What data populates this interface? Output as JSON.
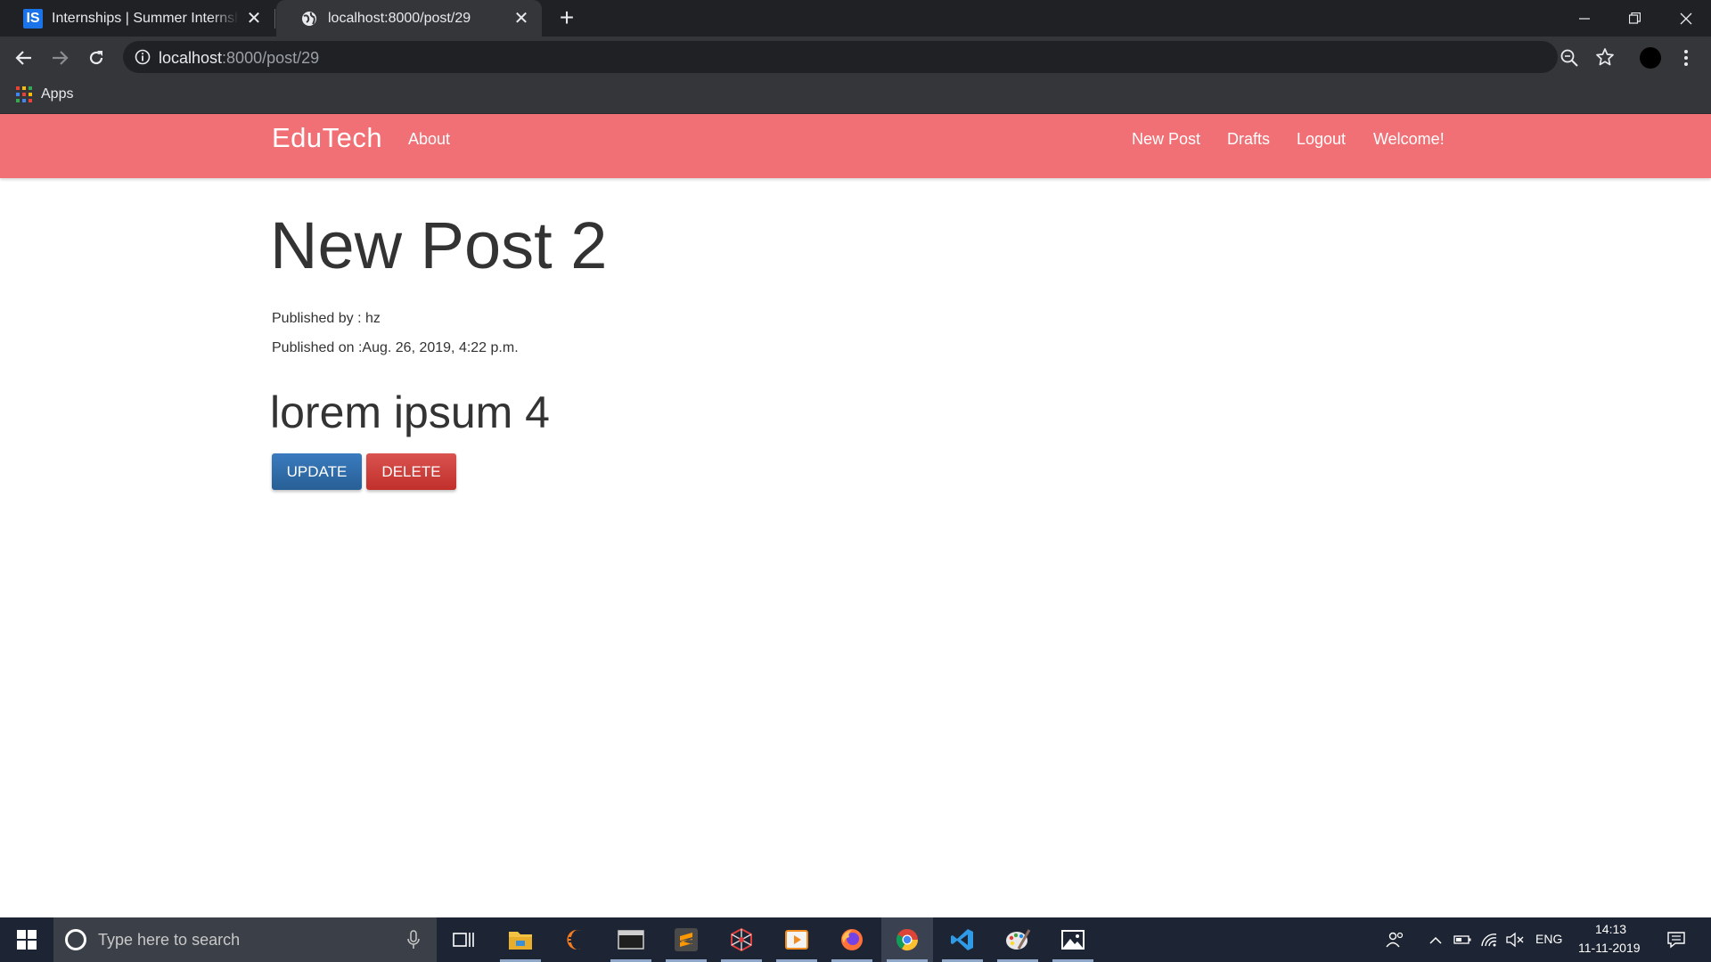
{
  "browser": {
    "tabs": [
      {
        "title": "Internships | Summer Internship | ",
        "favicon_text": "IS",
        "active": false
      },
      {
        "title": "localhost:8000/post/29",
        "favicon": "globe-icon",
        "active": true
      }
    ],
    "url_host": "localhost",
    "url_rest": ":8000/post/29",
    "bookmarks": {
      "apps_label": "Apps"
    }
  },
  "site": {
    "brand": "EduTech",
    "nav_left": [
      "About"
    ],
    "nav_right": [
      "New Post",
      "Drafts",
      "Logout",
      "Welcome!"
    ],
    "accent_color": "#f07075"
  },
  "post": {
    "title": "New Post 2",
    "published_by": "Published by : hz",
    "published_on": "Published on :Aug. 26, 2019, 4:22 p.m.",
    "body": "lorem ipsum 4",
    "update_label": "UPDATE",
    "delete_label": "DELETE"
  },
  "taskbar": {
    "search_placeholder": "Type here to search",
    "apps": [
      "task-view-icon",
      "file-explorer-icon",
      "eclipse-icon",
      "terminal-icon",
      "sublime-text-icon",
      "network-app-icon",
      "media-player-icon",
      "firefox-icon",
      "chrome-icon",
      "vscode-icon",
      "paint-icon",
      "photos-icon"
    ],
    "language": "ENG",
    "time": "14:13",
    "date": "11-11-2019"
  }
}
